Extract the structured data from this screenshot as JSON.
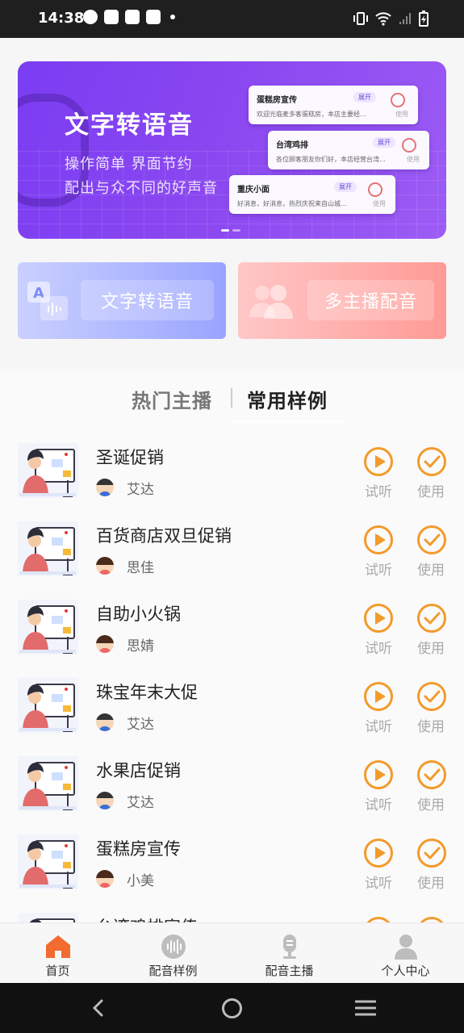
{
  "status_bar": {
    "time": "14:38"
  },
  "banner": {
    "title": "文字转语音",
    "subtitle_1": "操作简单 界面节约",
    "subtitle_2": "配出与众不同的好声音",
    "cards": [
      {
        "name": "蛋糕房宣传",
        "expand": "展开",
        "text": "欢迎光临麦多客蛋糕房，本店主要经…",
        "use": "使用"
      },
      {
        "name": "台湾鸡排",
        "expand": "展开",
        "text": "各位顾客朋友你们好，本店经营台湾…",
        "use": "使用"
      },
      {
        "name": "重庆小面",
        "expand": "展开",
        "text": "好消息，好消息，热烈庆祝来自山城…",
        "use": "使用"
      }
    ]
  },
  "features": {
    "text_to_speech": "文字转语音",
    "multi_anchor": "多主播配音"
  },
  "tabs": {
    "hot": "热门主播",
    "common": "常用样例",
    "active": "common"
  },
  "list": {
    "try_label": "试听",
    "use_label": "使用",
    "items": [
      {
        "title": "圣诞促销",
        "anchor": "艾达"
      },
      {
        "title": "百货商店双旦促销",
        "anchor": "思佳"
      },
      {
        "title": "自助小火锅",
        "anchor": "思婧"
      },
      {
        "title": "珠宝年末大促",
        "anchor": "艾达"
      },
      {
        "title": "水果店促销",
        "anchor": "艾达"
      },
      {
        "title": "蛋糕房宣传",
        "anchor": "小美"
      },
      {
        "title": "台湾鸡排宣传",
        "anchor": ""
      }
    ]
  },
  "bottom_nav": {
    "items": [
      {
        "label": "首页",
        "icon": "home-icon",
        "active": true
      },
      {
        "label": "配音样例",
        "icon": "waveform-icon",
        "active": false
      },
      {
        "label": "配音主播",
        "icon": "microphone-icon",
        "active": false
      },
      {
        "label": "个人中心",
        "icon": "user-icon",
        "active": false
      }
    ]
  },
  "colors": {
    "accent_orange": "#f39a2b",
    "banner_purple": "#8a47f0",
    "home_active": "#f26b2f"
  }
}
